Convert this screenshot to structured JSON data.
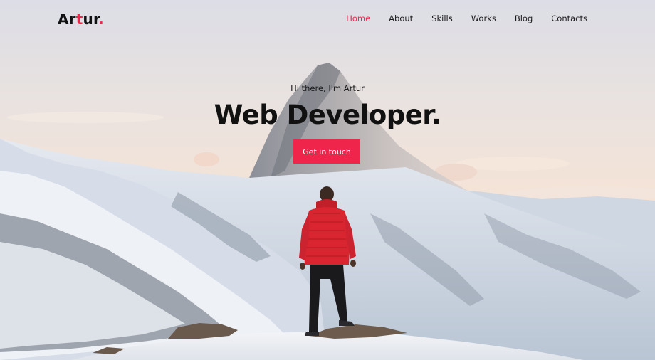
{
  "header": {
    "logo": {
      "prefix": "Ar",
      "accent_letter": "t",
      "suffix": "ur",
      "dot": "."
    },
    "nav": [
      {
        "label": "Home",
        "active": true
      },
      {
        "label": "About",
        "active": false
      },
      {
        "label": "Skills",
        "active": false
      },
      {
        "label": "Works",
        "active": false
      },
      {
        "label": "Blog",
        "active": false
      },
      {
        "label": "Contacts",
        "active": false
      }
    ]
  },
  "hero": {
    "intro": "Hi there, I'm Artur",
    "headline": "Web Developer.",
    "cta_label": "Get in touch"
  },
  "colors": {
    "accent": "#f0254b",
    "text": "#111111",
    "jacket": "#d9252f"
  }
}
